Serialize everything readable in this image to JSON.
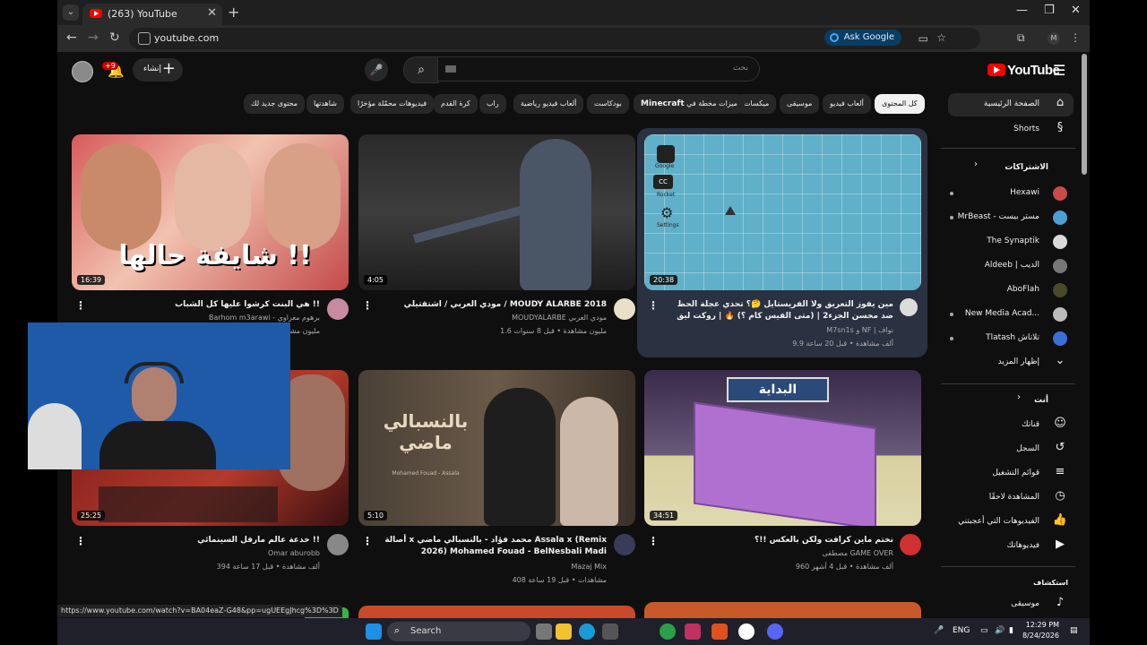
{
  "browser": {
    "tab_title": "(263) YouTube",
    "url": "youtube.com",
    "ask_google": "Ask Google",
    "profile_initial": "M",
    "status_url": "https://www.youtube.com/watch?v=BA04eaZ-G48&pp=ugUEEgJhcg%3D%3D"
  },
  "header": {
    "notif_badge": "+9",
    "create_label": "إنشاء",
    "search_placeholder": "بحث",
    "logo_text": "YouTube"
  },
  "chips": [
    {
      "label": "كل المحتوى",
      "active": true
    },
    {
      "label": "ألعاب فيديو"
    },
    {
      "label": "موسيقى"
    },
    {
      "label": "ميكسات"
    },
    {
      "label": "ميزات مخطة في"
    },
    {
      "label": "Minecraft"
    },
    {
      "label": "بودكاست"
    },
    {
      "label": "ألعاب فيديو رياضية"
    },
    {
      "label": "راب"
    },
    {
      "label": "كرة القدم"
    },
    {
      "label": "فيديوهات محمّلة مؤخرًا"
    },
    {
      "label": "شاهدتها"
    },
    {
      "label": "محتوى جديد لك"
    }
  ],
  "sidebar": {
    "home": "الصفحة الرئيسية",
    "shorts": "Shorts",
    "subs_title": "الاشتراكات",
    "subscriptions": [
      {
        "name": "Hexawi",
        "color": "#c94a4a"
      },
      {
        "name": "MrBeast - مستر بيست",
        "color": "#4aa0d5"
      },
      {
        "name": "The Synaptik",
        "color": "#d9d9d9"
      },
      {
        "name": "Aldeeb | الديب",
        "color": "#777777"
      },
      {
        "name": "AboFlah",
        "color": "#4a4a2a"
      },
      {
        "name": "New Media Acad...",
        "color": "#bbbbbb"
      },
      {
        "name": "Tlatash تلاتاش",
        "color": "#3b6fd6"
      }
    ],
    "show_more": "إظهار المزيد",
    "you_title": "أنت",
    "you_items": [
      "قناتك",
      "السجل",
      "قوائم التشغيل",
      "المشاهدة لاحقًا",
      "الفيديوهات التي أعجبتني",
      "فيديوهاتك"
    ],
    "explore_title": "استكشاف",
    "music": "موسيقى"
  },
  "videos": [
    {
      "title": "هي البنت كرشوا عليها كل الشباب !!",
      "channel": "Barhom m3arawi - برهوم معراوي",
      "meta": "8 مليون مشاهدة",
      "duration": "16:39",
      "thumb_text": "شايفة حالها !!"
    },
    {
      "title": "مودي العربي / اشتقتيلي / MOUDY ALARBE 2018",
      "channel": "MOUDYALARBE مودي العربي",
      "meta": "1.6 مليون مشاهدة • قبل 8 سنوات",
      "duration": "4:05"
    },
    {
      "title": "مين يفوز التعريق ولا الفريستايل 🤔؟ تحدي عجلة الحظ ضد محسن الجزء2 | (متى الفيس كام ؟) 🔥 | روكت ليق",
      "channel": "M7sn1s و NF | نواف",
      "meta": "9.9 ألف مشاهدة • قبل 20 ساعة",
      "duration": "20:38",
      "labels": [
        "Google",
        "Rocket",
        "Settings"
      ]
    },
    {
      "title": "خدعة عالم مارفل السينمائي !!",
      "channel": "Omar aburobb",
      "meta": "394 ألف مشاهدة • قبل 17 ساعة",
      "duration": "25:25"
    },
    {
      "title": "أصالة x محمد فؤاد - بالنسبالي ماضي Assala x (Remix 2026) Mohamed Fouad - BelNesbali Madi",
      "channel": "Mazaj Mix",
      "meta": "408 مشاهدات • قبل 19 ساعة",
      "duration": "5:10",
      "thumb_text": "بالنسبالي ماضي",
      "thumb_sub": "Mohamed Fouad - Assala"
    },
    {
      "title": "نختم ماين كرافت ولكن بالعكس !!؟",
      "channel": "مصطفى GAME OVER",
      "meta": "960 ألف مشاهدة • قبل 4 أشهر",
      "duration": "34:51",
      "thumb_text": "البداية"
    }
  ],
  "taskbar": {
    "search": "Search",
    "lang": "ENG",
    "time": "12:29 PM",
    "date": "8/24/2026"
  }
}
